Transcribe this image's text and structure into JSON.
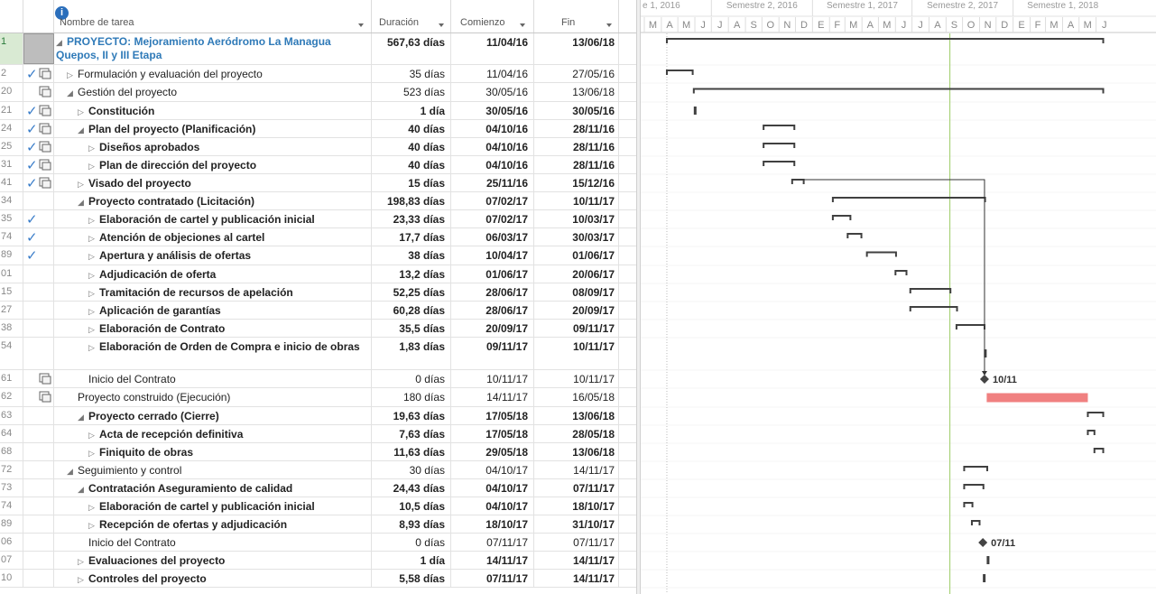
{
  "columns": {
    "info": "i",
    "name": "Nombre de tarea",
    "duration": "Duración",
    "start": "Comienzo",
    "end": "Fin"
  },
  "timescale": {
    "semesters": [
      {
        "label": "e 1, 2016"
      },
      {
        "label": "Semestre 2, 2016"
      },
      {
        "label": "Semestre 1, 2017"
      },
      {
        "label": "Semestre 2, 2017"
      },
      {
        "label": "Semestre 1, 2018"
      }
    ],
    "months": [
      "M",
      "A",
      "M",
      "J",
      "J",
      "A",
      "S",
      "O",
      "N",
      "D",
      "E",
      "F",
      "M",
      "A",
      "M",
      "J",
      "J",
      "A",
      "S",
      "O",
      "N",
      "D",
      "E",
      "F",
      "M",
      "A",
      "M",
      "J"
    ]
  },
  "tasks": [
    {
      "id": "1",
      "name": "PROYECTO: Mejoramiento Aeródromo La Managua Quepos, II y III Etapa",
      "duration": "567,63 días",
      "start": "11/04/16",
      "end": "13/06/18",
      "level": 0,
      "toggle": "collapse",
      "bold": true,
      "project": true,
      "check": false,
      "note": false
    },
    {
      "id": "2",
      "name": "Formulación y evaluación del proyecto",
      "duration": "35 días",
      "start": "11/04/16",
      "end": "27/05/16",
      "level": 1,
      "toggle": "expand",
      "bold": false,
      "check": true,
      "note": true
    },
    {
      "id": "20",
      "name": "Gestión del proyecto",
      "duration": "523 días",
      "start": "30/05/16",
      "end": "13/06/18",
      "level": 1,
      "toggle": "collapse",
      "bold": false,
      "check": false,
      "note": true
    },
    {
      "id": "21",
      "name": "Constitución",
      "duration": "1 día",
      "start": "30/05/16",
      "end": "30/05/16",
      "level": 2,
      "toggle": "expand",
      "bold": true,
      "check": true,
      "note": true
    },
    {
      "id": "24",
      "name": "Plan del proyecto (Planificación)",
      "duration": "40 días",
      "start": "04/10/16",
      "end": "28/11/16",
      "level": 2,
      "toggle": "collapse",
      "bold": true,
      "check": true,
      "note": true
    },
    {
      "id": "25",
      "name": "Diseños aprobados",
      "duration": "40 días",
      "start": "04/10/16",
      "end": "28/11/16",
      "level": 3,
      "toggle": "expand",
      "bold": true,
      "check": true,
      "note": true
    },
    {
      "id": "31",
      "name": "Plan de dirección del proyecto",
      "duration": "40 días",
      "start": "04/10/16",
      "end": "28/11/16",
      "level": 3,
      "toggle": "expand",
      "bold": true,
      "check": true,
      "note": true
    },
    {
      "id": "41",
      "name": "Visado del proyecto",
      "duration": "15 días",
      "start": "25/11/16",
      "end": "15/12/16",
      "level": 2,
      "toggle": "expand",
      "bold": true,
      "check": true,
      "note": true
    },
    {
      "id": "34",
      "name": "Proyecto contratado (Licitación)",
      "duration": "198,83 días",
      "start": "07/02/17",
      "end": "10/11/17",
      "level": 2,
      "toggle": "collapse",
      "bold": true,
      "check": false,
      "note": false
    },
    {
      "id": "35",
      "name": "Elaboración de cartel y publicación inicial",
      "duration": "23,33 días",
      "start": "07/02/17",
      "end": "10/03/17",
      "level": 3,
      "toggle": "expand",
      "bold": true,
      "check": true,
      "note": false
    },
    {
      "id": "74",
      "name": "Atención de objeciones al cartel",
      "duration": "17,7 días",
      "start": "06/03/17",
      "end": "30/03/17",
      "level": 3,
      "toggle": "expand",
      "bold": true,
      "check": true,
      "note": false
    },
    {
      "id": "89",
      "name": "Apertura y análisis de ofertas",
      "duration": "38 días",
      "start": "10/04/17",
      "end": "01/06/17",
      "level": 3,
      "toggle": "expand",
      "bold": true,
      "check": true,
      "note": false
    },
    {
      "id": "01",
      "name": "Adjudicación de oferta",
      "duration": "13,2 días",
      "start": "01/06/17",
      "end": "20/06/17",
      "level": 3,
      "toggle": "expand",
      "bold": true,
      "check": false,
      "note": false
    },
    {
      "id": "15",
      "name": "Tramitación de recursos de apelación",
      "duration": "52,25 días",
      "start": "28/06/17",
      "end": "08/09/17",
      "level": 3,
      "toggle": "expand",
      "bold": true,
      "check": false,
      "note": false
    },
    {
      "id": "27",
      "name": "Aplicación de garantías",
      "duration": "60,28 días",
      "start": "28/06/17",
      "end": "20/09/17",
      "level": 3,
      "toggle": "expand",
      "bold": true,
      "check": false,
      "note": false
    },
    {
      "id": "38",
      "name": "Elaboración de Contrato",
      "duration": "35,5 días",
      "start": "20/09/17",
      "end": "09/11/17",
      "level": 3,
      "toggle": "expand",
      "bold": true,
      "check": false,
      "note": false
    },
    {
      "id": "54",
      "name": "Elaboración de Orden de Compra e inicio de obras",
      "duration": "1,83 días",
      "start": "09/11/17",
      "end": "10/11/17",
      "level": 3,
      "toggle": "expand",
      "bold": true,
      "check": false,
      "note": false,
      "wrap": true
    },
    {
      "id": "61",
      "name": "Inicio del Contrato",
      "duration": "0 días",
      "start": "10/11/17",
      "end": "10/11/17",
      "level": 3,
      "toggle": "",
      "bold": false,
      "check": false,
      "note": true
    },
    {
      "id": "62",
      "name": "Proyecto construido (Ejecución)",
      "duration": "180 días",
      "start": "14/11/17",
      "end": "16/05/18",
      "level": 2,
      "toggle": "",
      "bold": false,
      "check": false,
      "note": true
    },
    {
      "id": "63",
      "name": "Proyecto cerrado (Cierre)",
      "duration": "19,63 días",
      "start": "17/05/18",
      "end": "13/06/18",
      "level": 2,
      "toggle": "collapse",
      "bold": true,
      "check": false,
      "note": false
    },
    {
      "id": "64",
      "name": "Acta de recepción definitiva",
      "duration": "7,63 días",
      "start": "17/05/18",
      "end": "28/05/18",
      "level": 3,
      "toggle": "expand",
      "bold": true,
      "check": false,
      "note": false
    },
    {
      "id": "68",
      "name": "Finiquito de obras",
      "duration": "11,63 días",
      "start": "29/05/18",
      "end": "13/06/18",
      "level": 3,
      "toggle": "expand",
      "bold": true,
      "check": false,
      "note": false
    },
    {
      "id": "72",
      "name": "Seguimiento y control",
      "duration": "30 días",
      "start": "04/10/17",
      "end": "14/11/17",
      "level": 1,
      "toggle": "collapse",
      "bold": false,
      "check": false,
      "note": false
    },
    {
      "id": "73",
      "name": "Contratación Aseguramiento de calidad",
      "duration": "24,43 días",
      "start": "04/10/17",
      "end": "07/11/17",
      "level": 2,
      "toggle": "collapse",
      "bold": true,
      "check": false,
      "note": false
    },
    {
      "id": "74",
      "name": "Elaboración de cartel y publicación inicial",
      "duration": "10,5 días",
      "start": "04/10/17",
      "end": "18/10/17",
      "level": 3,
      "toggle": "expand",
      "bold": true,
      "check": false,
      "note": false
    },
    {
      "id": "89",
      "name": "Recepción de ofertas y adjudicación",
      "duration": "8,93 días",
      "start": "18/10/17",
      "end": "31/10/17",
      "level": 3,
      "toggle": "expand",
      "bold": true,
      "check": false,
      "note": false
    },
    {
      "id": "06",
      "name": "Inicio del Contrato",
      "duration": "0 días",
      "start": "07/11/17",
      "end": "07/11/17",
      "level": 3,
      "toggle": "",
      "bold": false,
      "check": false,
      "note": false
    },
    {
      "id": "07",
      "name": "Evaluaciones del proyecto",
      "duration": "1 día",
      "start": "14/11/17",
      "end": "14/11/17",
      "level": 2,
      "toggle": "expand",
      "bold": true,
      "check": false,
      "note": false
    },
    {
      "id": "10",
      "name": "Controles del proyecto",
      "duration": "5,58 días",
      "start": "07/11/17",
      "end": "14/11/17",
      "level": 2,
      "toggle": "expand",
      "bold": true,
      "check": false,
      "note": false
    }
  ],
  "milestone_labels": {
    "m61": "10/11",
    "m06": "07/11"
  },
  "colors": {
    "critical_bar": "#f08080",
    "summary_bar": "#404040",
    "link": "#333333",
    "today_line": "#9ccc65",
    "checkmark": "#3a7dc9"
  }
}
